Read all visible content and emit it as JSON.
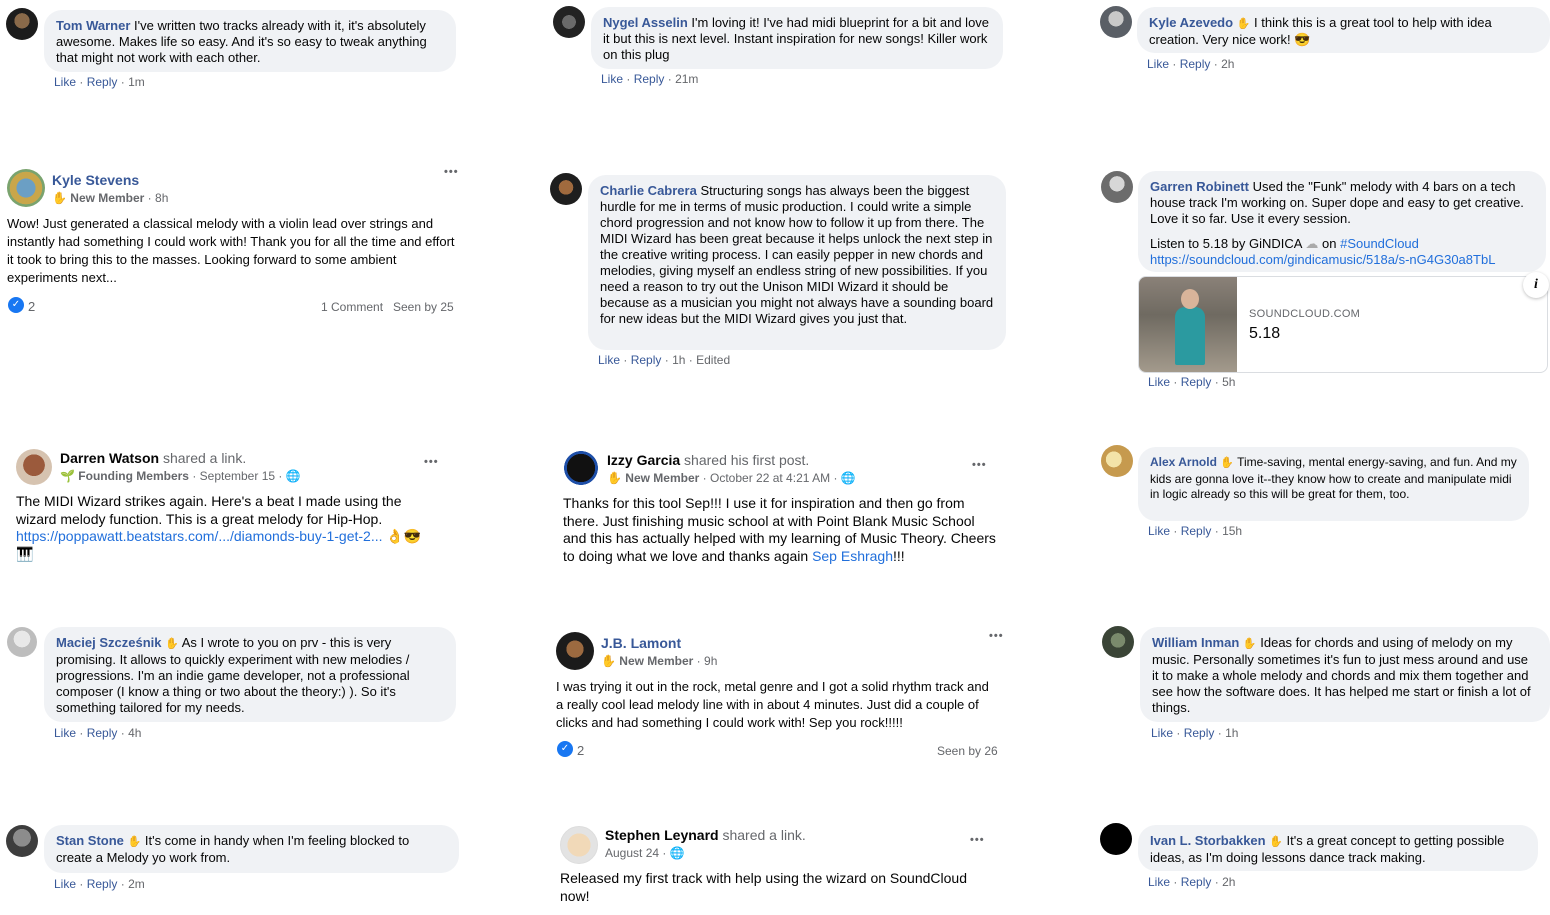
{
  "colors": {
    "link_blue": "#385898",
    "bubble_bg": "#f0f2f5",
    "like_blue": "#1877f2",
    "muted": "#65676b"
  },
  "icons": {
    "wave": "✋",
    "globe": "🌐",
    "more": "•••",
    "like": "👍"
  },
  "actions": {
    "like": "Like",
    "reply": "Reply",
    "sep": "·"
  },
  "comments": [
    {
      "author": "Tom Warner",
      "text": "I've written two tracks already with it, it's absolutely awesome. Makes life so easy. And it's so easy to tweak anything that might not work with each other.",
      "time": "1m"
    },
    {
      "author": "Nygel Asselin",
      "text": "I'm loving it! I've had midi blueprint for a bit and love it but this is next level. Instant inspiration for new songs! Killer work on this plug",
      "time": "21m"
    },
    {
      "author": "Kyle Azevedo",
      "text": "I think this is a great tool to help with idea creation. Very nice work! 😎",
      "time": "2h"
    },
    {
      "author": "Charlie Cabrera",
      "text": "Structuring songs has always been the biggest hurdle for me in terms of music production. I could write a simple chord progression and not know how to follow it up from there. The MIDI Wizard has been great because it helps unlock the next step in the creative writing process. I can easily pepper in new chords and melodies, giving myself an endless string of new possibilities. If you need a reason to try out the Unison MIDI Wizard it should be because as a musician you might not always have a sounding board for new ideas but the MIDI Wizard gives you just that.",
      "time": "1h",
      "edited": "Edited"
    },
    {
      "author": "Garren Robinett",
      "text": "Used the \"Funk\" melody with 4 bars on a tech house track I'm working on. Super dope and easy to get creative. Love it so far. Use it every session.",
      "listen": "Listen to 5.18 by GiNDICA",
      "on": "on",
      "hashtag": "#SoundCloud",
      "url": "https://soundcloud.com/gindicamusic/518a/s-nG4G30a8TbL",
      "card_domain": "SOUNDCLOUD.COM",
      "card_title": "5.18",
      "card_info": "i",
      "time": "5h"
    },
    {
      "author": "Alex Arnold",
      "text": "Time-saving, mental energy-saving, and fun. And my kids are gonna love it--they know how to create and manipulate midi in logic already so this will be great for them, too.",
      "time": "15h"
    },
    {
      "author": "Maciej Szcześnik",
      "text": "As I wrote to you on prv - this is very promising. It allows to quickly experiment with new melodies / progressions. I'm an indie game developer, not a professional composer (I know a thing or two about the theory:) ). So it's something tailored for my needs.",
      "time": "4h"
    },
    {
      "author": "William Inman",
      "text": "Ideas for chords and using of melody on my music. Personally sometimes it's fun to just mess around and use it to make a whole melody and chords and mix them together and see how the software does. It has helped me start or finish a lot of things.",
      "time": "1h"
    },
    {
      "author": "Stan Stone",
      "text": "It's come in handy when I'm feeling blocked to create a Melody yo work from.",
      "time": "2m"
    },
    {
      "author": "Ivan L. Storbakken",
      "text": "It's a great concept to getting possible ideas, as I'm doing lessons dance track making.",
      "time": "2h"
    }
  ],
  "posts": [
    {
      "author": "Kyle Stevens",
      "badge": "New Member",
      "time": "8h",
      "text": "Wow! Just generated a classical melody with a violin lead over strings and instantly had something I could work with! Thank you for all the time and effort it took to bring this to the masses. Looking forward to some ambient experiments next...",
      "reactions": "2",
      "comments": "1 Comment",
      "seen": "Seen by 25"
    },
    {
      "author": "Darren Watson",
      "shared": "shared a link.",
      "badge": "Founding Members",
      "time": "September 15",
      "text": "The MIDI Wizard strikes again. Here's a beat I made using the wizard melody function. This is a great melody for Hip-Hop.",
      "link": "https://poppawatt.beatstars.com/.../diamonds-buy-1-get-2...",
      "emoji": "👌😎 🎹"
    },
    {
      "author": "Izzy Garcia",
      "shared": "shared his first post.",
      "badge": "New Member",
      "time": "October 22 at 4:21 AM",
      "text": "Thanks for this tool Sep!!! I use it for inspiration and then go from there. Just finishing music school at with Point Blank Music School and this has actually helped with my learning of Music Theory. Cheers to doing what we love and thanks again",
      "mention": "Sep Eshragh",
      "tail": "!!!"
    },
    {
      "author": "J.B. Lamont",
      "badge": "New Member",
      "time": "9h",
      "text": "I was trying it out in the rock, metal genre and I got a solid rhythm track and a really cool lead melody line with in about 4 minutes. Just did a couple of clicks and had something I could work with! Sep you rock!!!!!",
      "reactions": "2",
      "seen": "Seen by 26"
    },
    {
      "author": "Stephen Leynard",
      "shared": "shared a link.",
      "time": "August 24",
      "text": "Released my first track with help using the wizard on SoundCloud now!"
    }
  ]
}
